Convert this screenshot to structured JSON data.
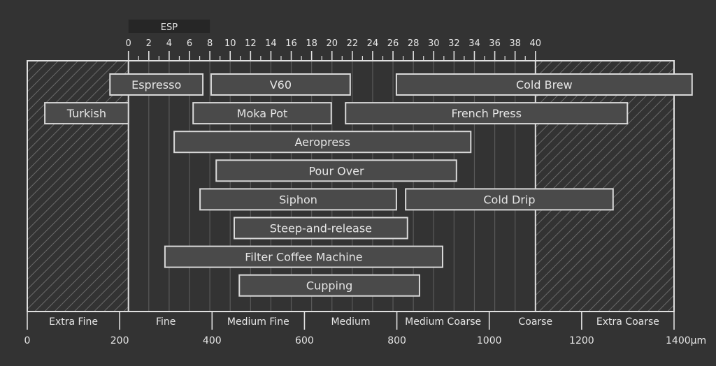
{
  "chart_data": {
    "type": "bar",
    "subtype": "range-gantt",
    "title": "",
    "unit": "µm",
    "xlim": [
      0,
      1400
    ],
    "x_ticks": [
      0,
      200,
      400,
      600,
      800,
      1000,
      1200,
      1400
    ],
    "x_tick_labels": [
      "0",
      "200",
      "400",
      "600",
      "800",
      "1000",
      "1200",
      "1400µm"
    ],
    "categories_bands": [
      {
        "label": "Extra Fine",
        "from": 0,
        "to": 200
      },
      {
        "label": "Fine",
        "from": 200,
        "to": 400
      },
      {
        "label": "Medium Fine",
        "from": 400,
        "to": 600
      },
      {
        "label": "Medium",
        "from": 600,
        "to": 800
      },
      {
        "label": "Medium Coarse",
        "from": 800,
        "to": 1000
      },
      {
        "label": "Coarse",
        "from": 1000,
        "to": 1200
      },
      {
        "label": "Extra Coarse",
        "from": 1200,
        "to": 1400
      }
    ],
    "grinder_scale": {
      "label": "ESP",
      "min": 0,
      "max": 40,
      "min_um": 219,
      "max_um": 1100,
      "tick_labels": [
        "0",
        "2",
        "4",
        "6",
        "8",
        "10",
        "12",
        "14",
        "16",
        "18",
        "20",
        "22",
        "24",
        "26",
        "28",
        "30",
        "32",
        "34",
        "36",
        "38",
        "40"
      ],
      "minor_step": 1
    },
    "hatched_ranges_um": [
      [
        0,
        219
      ],
      [
        1100,
        1400
      ]
    ],
    "series": [
      {
        "name": "Espresso",
        "row": 0,
        "from": 179,
        "to": 380
      },
      {
        "name": "V60",
        "row": 0,
        "from": 398,
        "to": 699
      },
      {
        "name": "Cold Brew",
        "row": 0,
        "from": 799,
        "to": 1439
      },
      {
        "name": "Turkish",
        "row": 1,
        "from": 38,
        "to": 219
      },
      {
        "name": "Moka Pot",
        "row": 1,
        "from": 359,
        "to": 658
      },
      {
        "name": "French Press",
        "row": 1,
        "from": 689,
        "to": 1299
      },
      {
        "name": "Aeropress",
        "row": 2,
        "from": 318,
        "to": 960
      },
      {
        "name": "Pour Over",
        "row": 3,
        "from": 409,
        "to": 929
      },
      {
        "name": "Siphon",
        "row": 4,
        "from": 374,
        "to": 799
      },
      {
        "name": "Cold Drip",
        "row": 4,
        "from": 819,
        "to": 1268
      },
      {
        "name": "Steep-and-release",
        "row": 5,
        "from": 448,
        "to": 823
      },
      {
        "name": "Filter Coffee Machine",
        "row": 6,
        "from": 298,
        "to": 899
      },
      {
        "name": "Cupping",
        "row": 7,
        "from": 459,
        "to": 849
      }
    ],
    "colors": {
      "background": "#333333",
      "bar_fill": "#4a4a4a",
      "bar_stroke": "#d9d9d9",
      "axis": "#e0e0e0",
      "grid": "#5a5a5a",
      "hatch": "#6a6a6a",
      "esp_label_bg": "#262626",
      "text": "#e6e6e6"
    }
  }
}
